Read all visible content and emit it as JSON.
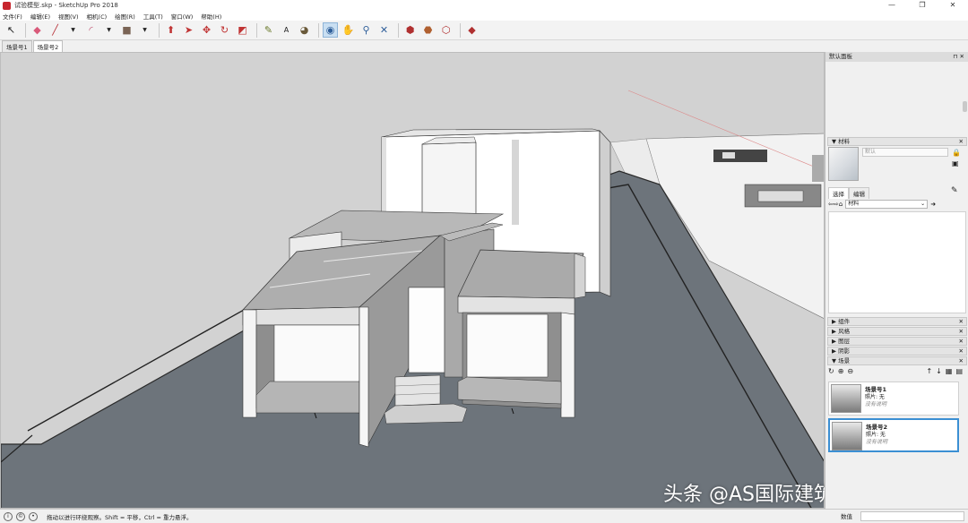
{
  "window": {
    "title": "试验模型.skp - SketchUp Pro 2018",
    "controls": [
      "—",
      "❐",
      "✕"
    ]
  },
  "menu": [
    "文件(F)",
    "编辑(E)",
    "视图(V)",
    "相机(C)",
    "绘图(R)",
    "工具(T)",
    "窗口(W)",
    "帮助(H)"
  ],
  "scene_tabs": [
    {
      "label": "场景号1",
      "selected": false
    },
    {
      "label": "场景号2",
      "selected": true
    }
  ],
  "tray": {
    "title": "默认面板",
    "materials": {
      "header": "材料",
      "name_placeholder": "默认",
      "tabs": [
        "选择",
        "编辑"
      ],
      "dropdown": "材料"
    },
    "sections": [
      "组件",
      "风格",
      "图层",
      "阴影",
      "场景"
    ],
    "scenes": [
      {
        "name": "场景号1",
        "photo": "照片: 无",
        "note": "没有说明"
      },
      {
        "name": "场景号2",
        "photo": "照片: 无",
        "note": "没有说明"
      }
    ]
  },
  "status": {
    "hint": "拖动以进行环绕观察。Shift = 平移，Ctrl = 重力悬浮。",
    "measure_label": "数值"
  },
  "watermark": "头条 @AS国际建筑与空间"
}
